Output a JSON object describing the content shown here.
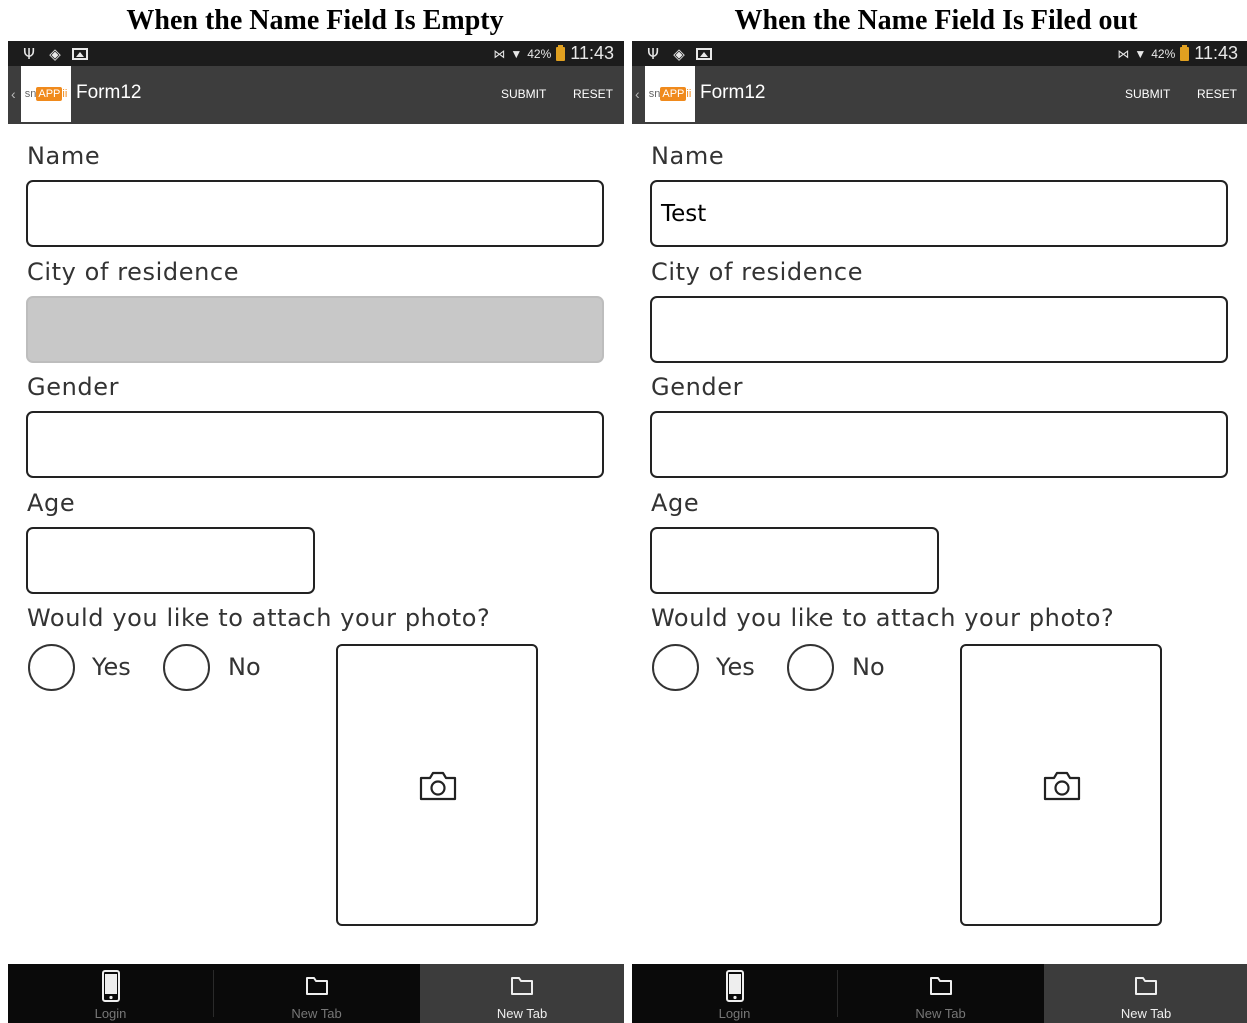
{
  "headings": {
    "left": "When the Name Field Is Empty",
    "right": "When the Name Field Is Filed out"
  },
  "panels": [
    {
      "status_bar": {
        "battery_pct": "42%",
        "time": "11:43"
      },
      "action_bar": {
        "logo_sn": "sn",
        "logo_app": "APP",
        "logo_ii": "ii",
        "title": "Form12",
        "submit": "SUBMIT",
        "reset": "RESET"
      },
      "form": {
        "name_label": "Name",
        "name_value": "",
        "city_label": "City of residence",
        "city_value": "",
        "city_disabled": true,
        "gender_label": "Gender",
        "gender_value": "",
        "age_label": "Age",
        "age_value": "",
        "photo_question": "Would you like to attach your photo?",
        "yes_label": "Yes",
        "no_label": "No"
      },
      "tabs": [
        {
          "label": "Login",
          "icon": "phone-icon",
          "active": false
        },
        {
          "label": "New Tab",
          "icon": "folder-icon",
          "active": false
        },
        {
          "label": "New Tab",
          "icon": "folder-icon",
          "active": true
        }
      ]
    },
    {
      "status_bar": {
        "battery_pct": "42%",
        "time": "11:43"
      },
      "action_bar": {
        "logo_sn": "sn",
        "logo_app": "APP",
        "logo_ii": "ii",
        "title": "Form12",
        "submit": "SUBMIT",
        "reset": "RESET"
      },
      "form": {
        "name_label": "Name",
        "name_value": "Test",
        "city_label": "City of residence",
        "city_value": "",
        "city_disabled": false,
        "gender_label": "Gender",
        "gender_value": "",
        "age_label": "Age",
        "age_value": "",
        "photo_question": "Would you like to attach your photo?",
        "yes_label": "Yes",
        "no_label": "No"
      },
      "tabs": [
        {
          "label": "Login",
          "icon": "phone-icon",
          "active": false
        },
        {
          "label": "New Tab",
          "icon": "folder-icon",
          "active": false
        },
        {
          "label": "New Tab",
          "icon": "folder-icon",
          "active": true
        }
      ]
    }
  ]
}
